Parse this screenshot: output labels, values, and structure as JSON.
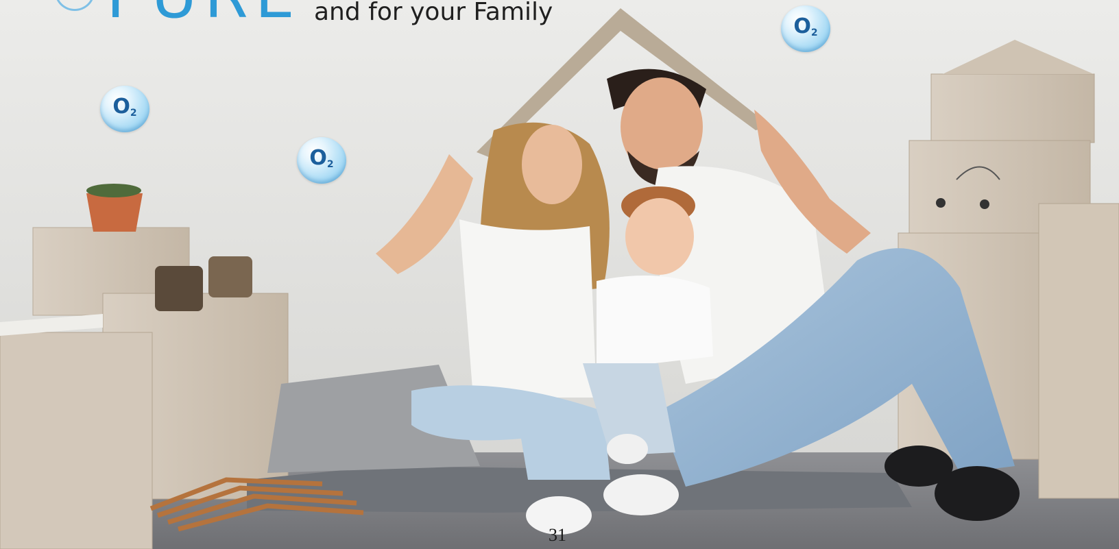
{
  "headline": {
    "brand_word": "PURE",
    "tagline": "and for your Family"
  },
  "oxygen_bubbles": [
    {
      "label": "O",
      "subscript": "2"
    },
    {
      "label": "O",
      "subscript": "2"
    },
    {
      "label": "O",
      "subscript": "2"
    }
  ],
  "footer": {
    "page_number": "31"
  },
  "colors": {
    "brand_blue": "#2e9ad6",
    "bubble_text": "#1c5f9c",
    "tagline": "#1f1f1f"
  },
  "icons": [
    "oxygen-bubble-icon",
    "logo-arc-icon"
  ]
}
